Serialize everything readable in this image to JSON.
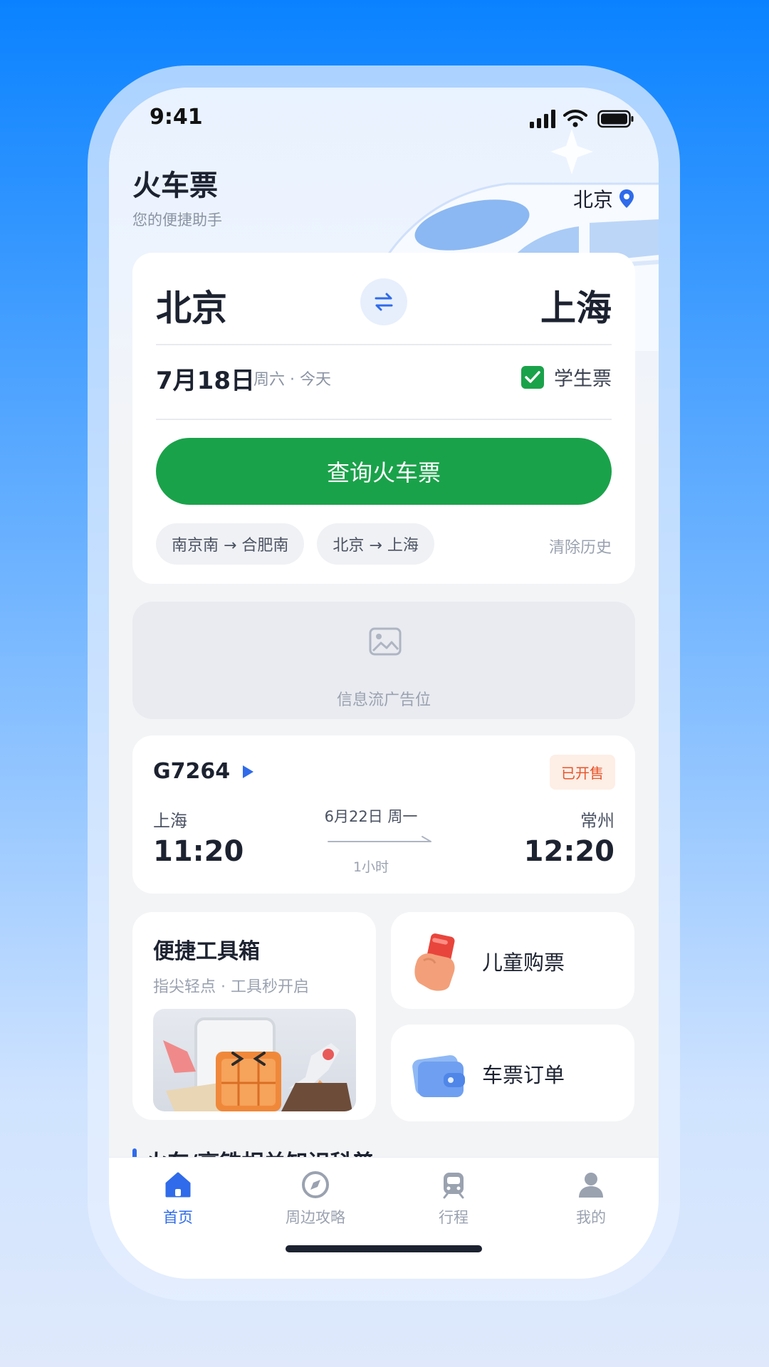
{
  "status_bar": {
    "time": "9:41"
  },
  "header": {
    "title": "火车票",
    "subtitle": "您的便捷助手",
    "city": "北京",
    "location_icon": "location-pin-icon"
  },
  "search": {
    "from": "北京",
    "to": "上海",
    "swap_icon": "swap-arrows-icon",
    "date": "7月18日",
    "weekday": "周六 · 今天",
    "student_ticket_label": "学生票",
    "student_ticket_checked": true,
    "search_button": "查询火车票",
    "history": [
      "南京南 → 合肥南",
      "北京 → 上海"
    ],
    "clear_history": "清除历史"
  },
  "ad": {
    "label": "信息流广告位",
    "icon": "image-placeholder-icon"
  },
  "train": {
    "number": "G7264",
    "status": "已开售",
    "depart_station": "上海",
    "depart_time": "11:20",
    "date": "6月22日 周一",
    "duration": "1小时",
    "arrive_station": "常州",
    "arrive_time": "12:20"
  },
  "toolbox": {
    "title": "便捷工具箱",
    "subtitle": "指尖轻点 · 工具秒开启"
  },
  "quick": {
    "kids": "儿童购票",
    "orders": "车票订单"
  },
  "section": {
    "title": "火车/高铁相关知识科普"
  },
  "tabs": [
    {
      "label": "首页",
      "icon": "home-icon",
      "active": true
    },
    {
      "label": "周边攻略",
      "icon": "compass-icon",
      "active": false
    },
    {
      "label": "行程",
      "icon": "train-icon",
      "active": false
    },
    {
      "label": "我的",
      "icon": "user-icon",
      "active": false
    }
  ],
  "colors": {
    "accent_green": "#1aa24a",
    "accent_blue": "#2f6bea",
    "badge_orange": "#e8552b",
    "background_blue": "#0a82ff"
  }
}
